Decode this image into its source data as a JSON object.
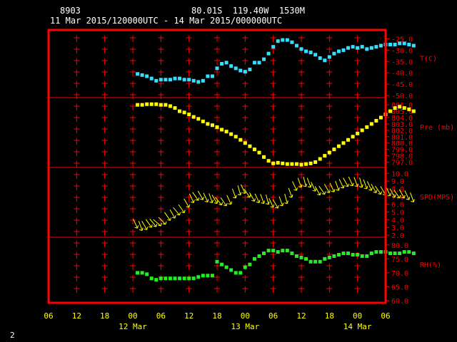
{
  "header": {
    "station_id": "8903",
    "location": "80.01S  119.40W  1530M",
    "time_range": "11 Mar 2015/120000UTC - 14 Mar 2015/000000UTC"
  },
  "footer": {
    "page": "2"
  },
  "colors": {
    "frame": "#ff0000",
    "tick_labels": "#ff0000",
    "x_labels": "#ffff00",
    "temperature": "#33e0ff",
    "pressure": "#ffff00",
    "wind": "#ffff00",
    "rh": "#22ee22"
  },
  "chart_data": [
    {
      "type": "scatter",
      "series": [
        {
          "name": "T(C)",
          "x": [
            13.0,
            14.0,
            15.0,
            16.0,
            17.0,
            18.0,
            19.0,
            20.0,
            21.0,
            22.0,
            23.0,
            24.0,
            25.0,
            26.0,
            27.0,
            28.0,
            29.0,
            30.0,
            31.0,
            32.0,
            33.0,
            34.0,
            35.0,
            36.0,
            37.0,
            38.0,
            39.0,
            40.0,
            41.0,
            42.0,
            43.0,
            44.0,
            45.0,
            46.0,
            47.0,
            48.0,
            49.0,
            50.0,
            51.0,
            52.0,
            53.0,
            54.0,
            55.0,
            56.0,
            57.0,
            58.0,
            59.0,
            60.0,
            61.0,
            62.0,
            63.0,
            64.0,
            65.0,
            66.0,
            67.0,
            68.0,
            69.0,
            70.0,
            71.0,
            72.0
          ],
          "values": [
            -40.5,
            -41.0,
            -41.5,
            -42.5,
            -43.5,
            -43.0,
            -43.0,
            -43.0,
            -42.5,
            -42.5,
            -43.0,
            -43.0,
            -43.5,
            -44.0,
            -43.5,
            -41.5,
            -41.5,
            -38.0,
            -36.0,
            -35.5,
            -37.0,
            -38.0,
            -39.0,
            -39.5,
            -38.5,
            -35.5,
            -35.5,
            -34.0,
            -31.5,
            -28.5,
            -26.0,
            -25.5,
            -25.5,
            -26.5,
            -28.0,
            -29.5,
            -30.5,
            -31.0,
            -32.0,
            -33.5,
            -34.5,
            -33.0,
            -31.5,
            -30.5,
            -30.0,
            -29.0,
            -28.5,
            -29.0,
            -28.5,
            -29.5,
            -29.0,
            -28.5,
            -28.0,
            -27.5,
            -27.5,
            -27.5,
            -27.0,
            -27.0,
            -27.5,
            -28.0
          ]
        }
      ],
      "ylabel": "T(C)",
      "yticks": [
        -50.0,
        -45.0,
        -40.0,
        -35.0,
        -30.0,
        -25.0
      ],
      "ylim": [
        -50.0,
        -22.0
      ]
    },
    {
      "type": "scatter",
      "series": [
        {
          "name": "Pre (mb)",
          "x": [
            13.0,
            14.0,
            15.0,
            16.0,
            17.0,
            18.0,
            19.0,
            20.0,
            21.0,
            22.0,
            23.0,
            24.0,
            25.0,
            26.0,
            27.0,
            28.0,
            29.0,
            30.0,
            31.0,
            32.0,
            33.0,
            34.0,
            35.0,
            36.0,
            37.0,
            38.0,
            39.0,
            40.0,
            41.0,
            42.0,
            43.0,
            44.0,
            45.0,
            46.0,
            47.0,
            48.0,
            49.0,
            50.0,
            51.0,
            52.0,
            53.0,
            54.0,
            55.0,
            56.0,
            57.0,
            58.0,
            59.0,
            60.0,
            61.0,
            62.0,
            63.0,
            64.0,
            65.0,
            66.0,
            67.0,
            68.0,
            69.0,
            70.0,
            71.0,
            72.0
          ],
          "values": [
            806.0,
            806.0,
            806.1,
            806.1,
            806.1,
            806.0,
            806.0,
            805.8,
            805.5,
            805.0,
            804.8,
            804.5,
            804.1,
            803.8,
            803.4,
            803.0,
            802.8,
            802.5,
            802.1,
            801.8,
            801.4,
            801.0,
            800.5,
            800.0,
            799.5,
            799.0,
            798.5,
            797.8,
            797.2,
            796.8,
            796.9,
            796.8,
            796.7,
            796.7,
            796.7,
            796.6,
            796.7,
            796.8,
            797.0,
            797.5,
            798.0,
            798.5,
            799.0,
            799.5,
            800.0,
            800.5,
            801.0,
            801.5,
            802.0,
            802.5,
            803.0,
            803.5,
            804.0,
            804.5,
            805.0,
            805.5,
            805.7,
            805.5,
            805.3,
            805.0
          ]
        }
      ],
      "ylabel": "Pre (mb)",
      "yticks": [
        797.0,
        798.0,
        799.0,
        800.0,
        801.0,
        802.0,
        803.0,
        804.0,
        805.0,
        806.0
      ],
      "ylim": [
        796.5,
        806.8
      ]
    },
    {
      "type": "scatter",
      "series": [
        {
          "name": "SPD(MPS)",
          "x": [
            13.0,
            14.0,
            15.0,
            16.0,
            17.0,
            18.0,
            19.0,
            20.0,
            21.0,
            22.0,
            23.0,
            24.0,
            25.0,
            26.0,
            27.0,
            28.0,
            29.0,
            30.0,
            31.0,
            32.0,
            33.0,
            34.0,
            35.0,
            36.0,
            37.0,
            38.0,
            39.0,
            40.0,
            41.0,
            42.0,
            43.0,
            44.0,
            45.0,
            46.0,
            47.0,
            48.0,
            49.0,
            50.0,
            51.0,
            52.0,
            53.0,
            54.0,
            55.0,
            56.0,
            57.0,
            58.0,
            59.0,
            60.0,
            61.0,
            62.0,
            63.0,
            64.0,
            65.0,
            66.0,
            67.0,
            68.0,
            69.0,
            70.0,
            71.0,
            72.0
          ],
          "values": [
            2.9,
            2.6,
            2.7,
            3.0,
            3.1,
            3.2,
            3.4,
            3.9,
            4.2,
            4.6,
            4.9,
            5.6,
            6.2,
            6.5,
            6.6,
            6.3,
            6.2,
            6.1,
            5.9,
            5.8,
            6.0,
            6.8,
            7.2,
            7.4,
            6.9,
            6.4,
            6.2,
            6.1,
            6.0,
            5.6,
            5.5,
            5.8,
            6.1,
            6.9,
            7.8,
            8.2,
            8.3,
            8.2,
            7.7,
            7.2,
            7.3,
            7.5,
            7.6,
            7.8,
            8.1,
            8.3,
            8.4,
            8.3,
            8.2,
            8.0,
            7.8,
            7.5,
            7.3,
            7.2,
            7.1,
            6.9,
            6.8,
            6.8,
            6.6,
            6.3
          ],
          "direction": [
            25,
            20,
            30,
            35,
            40,
            50,
            45,
            35,
            30,
            40,
            35,
            30,
            25,
            35,
            30,
            25,
            20,
            30,
            40,
            35,
            25,
            20,
            15,
            25,
            35,
            30,
            25,
            20,
            15,
            25,
            30,
            20,
            15,
            20,
            25,
            20,
            15,
            20,
            25,
            30,
            35,
            30,
            25,
            20,
            25,
            30,
            25,
            20,
            15,
            20,
            25,
            30,
            35,
            30,
            25,
            30,
            35,
            30,
            25,
            20
          ]
        }
      ],
      "ylabel": "SPD(MPS)",
      "yticks": [
        2.0,
        3.0,
        4.0,
        5.0,
        6.0,
        7.0,
        8.0,
        9.0,
        10.0
      ],
      "ylim": [
        2.0,
        10.5
      ]
    },
    {
      "type": "scatter",
      "series": [
        {
          "name": "RH(%)",
          "x": [
            13.0,
            14.0,
            15.0,
            16.0,
            17.0,
            18.0,
            19.0,
            20.0,
            21.0,
            22.0,
            23.0,
            24.0,
            25.0,
            26.0,
            27.0,
            28.0,
            29.0,
            30.0,
            31.0,
            32.0,
            33.0,
            34.0,
            35.0,
            36.0,
            37.0,
            38.0,
            39.0,
            40.0,
            41.0,
            42.0,
            43.0,
            44.0,
            45.0,
            46.0,
            47.0,
            48.0,
            49.0,
            50.0,
            51.0,
            52.0,
            53.0,
            54.0,
            55.0,
            56.0,
            57.0,
            58.0,
            59.0,
            60.0,
            61.0,
            62.0,
            63.0,
            64.0,
            65.0,
            66.0,
            67.0,
            68.0,
            69.0,
            70.0,
            71.0,
            72.0
          ],
          "values": [
            70.0,
            70.0,
            69.5,
            68.0,
            67.5,
            68.0,
            68.0,
            68.0,
            68.0,
            68.0,
            68.0,
            68.0,
            68.0,
            68.5,
            69.0,
            69.0,
            69.0,
            74.0,
            73.0,
            72.0,
            71.0,
            70.0,
            70.0,
            72.0,
            73.0,
            75.0,
            76.0,
            77.0,
            78.0,
            78.0,
            77.5,
            78.0,
            78.0,
            77.0,
            76.0,
            75.5,
            75.0,
            74.0,
            74.0,
            74.0,
            75.0,
            75.5,
            76.0,
            76.5,
            77.0,
            77.0,
            76.5,
            76.5,
            76.0,
            76.0,
            77.0,
            77.5,
            77.5,
            77.5,
            77.0,
            77.0,
            77.0,
            77.5,
            77.5,
            77.0
          ],
          "color": "#22ee22"
        }
      ],
      "ylabel": "RH(%)",
      "yticks": [
        60.0,
        65.0,
        70.0,
        75.0,
        80.0
      ],
      "ylim": [
        60.0,
        82.0
      ]
    }
  ],
  "x_axis": {
    "hour_labels": [
      "06",
      "12",
      "18",
      "00",
      "06",
      "12",
      "18",
      "00",
      "06",
      "12",
      "18",
      "00",
      "06"
    ],
    "hours_from_start": [
      -6,
      0,
      6,
      12,
      18,
      24,
      30,
      36,
      42,
      48,
      54,
      60,
      66
    ],
    "date_labels": [
      "12 Mar",
      "13 Mar",
      "14 Mar"
    ],
    "date_hours": [
      12,
      36,
      60
    ],
    "xlim": [
      -6,
      66
    ]
  }
}
